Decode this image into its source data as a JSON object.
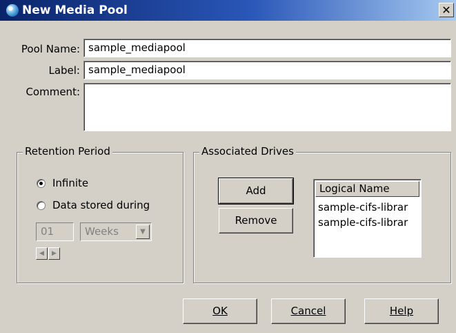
{
  "window": {
    "title": "New Media Pool",
    "close_glyph": "✕"
  },
  "form": {
    "pool_name_label": "Pool Name:",
    "pool_name_value": "sample_mediapool",
    "label_label": "Label:",
    "label_value": "sample_mediapool",
    "comment_label": "Comment:",
    "comment_value": ""
  },
  "retention": {
    "legend": "Retention Period",
    "options": [
      {
        "label": "Infinite",
        "checked": true
      },
      {
        "label": "Data stored during",
        "checked": false
      }
    ],
    "period_value": "01",
    "period_unit": "Weeks"
  },
  "drives": {
    "legend": "Associated Drives",
    "add_label": "Add",
    "remove_label": "Remove",
    "column_header": "Logical Name",
    "items": [
      "sample-cifs-librar",
      "sample-cifs-librar"
    ]
  },
  "footer": {
    "ok_label": "OK",
    "cancel_label": "Cancel",
    "help_label": "Help"
  }
}
